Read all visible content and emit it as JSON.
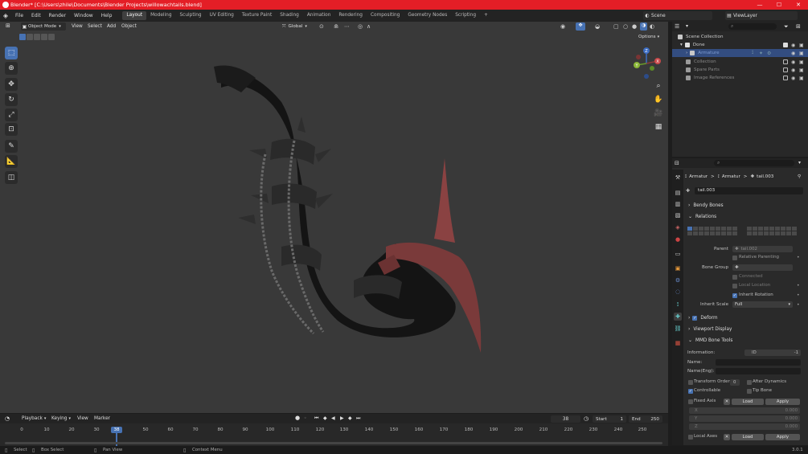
{
  "app": {
    "title": "Blender* [C:\\Users\\zhile\\Documents\\Blender Projects\\willowachtails.blend]"
  },
  "window_controls": {
    "minimize": "—",
    "maximize": "☐",
    "close": "✕"
  },
  "menu": {
    "items": [
      "File",
      "Edit",
      "Render",
      "Window",
      "Help"
    ]
  },
  "workspaces": {
    "tabs": [
      "Layout",
      "Modeling",
      "Sculpting",
      "UV Editing",
      "Texture Paint",
      "Shading",
      "Animation",
      "Rendering",
      "Compositing",
      "Geometry Nodes",
      "Scripting"
    ],
    "active": "Layout",
    "add": "+"
  },
  "scene": {
    "name": "Scene",
    "view_layer": "ViewLayer"
  },
  "viewport": {
    "mode": "Object Mode",
    "menus": [
      "View",
      "Select",
      "Add",
      "Object"
    ],
    "orientation": "Global",
    "options_label": "Options"
  },
  "gizmo": {
    "x": "X",
    "y": "Y",
    "z": "Z"
  },
  "outliner": {
    "search_placeholder": "",
    "root": "Scene Collection",
    "rows": [
      {
        "label": "Done"
      },
      {
        "label": "Armature"
      },
      {
        "label": "Collection"
      },
      {
        "label": "Spare Parts"
      },
      {
        "label": "Image References"
      }
    ]
  },
  "properties": {
    "breadcrumb": {
      "a": "Armatur",
      "b": "Armatur",
      "c": "tail.003",
      "sep": ">"
    },
    "bone_name": "tail.003",
    "panels": {
      "bendy": "Bendy Bones",
      "relations": "Relations",
      "deform": "Deform",
      "viewport_display": "Viewport Display",
      "mmd": "MMD Bone Tools"
    },
    "relations": {
      "parent_label": "Parent",
      "parent_value": "tail.002",
      "relative_parenting": "Relative Parenting",
      "bone_group_label": "Bone Group",
      "connected": "Connected",
      "local_location": "Local Location",
      "inherit_rotation": "Inherit Rotation",
      "inherit_scale_label": "Inherit Scale",
      "inherit_scale_value": "Full"
    },
    "mmd": {
      "information_label": "Information:",
      "id_label": "ID",
      "id_value": "-1",
      "name_label": "Name:",
      "name_eng_label": "Name(Eng):",
      "transform_order_label": "Transform Order",
      "transform_order_value": "0",
      "after_dynamics": "After Dynamics",
      "controllable": "Controllable",
      "tip_bone": "Tip Bone",
      "fixed_axis": "Fixed Axis",
      "local_axes": "Local Axes",
      "load": "Load",
      "apply": "Apply",
      "x_label": "X",
      "y_label": "Y",
      "z_label": "Z",
      "x_value": "0.000",
      "y_value": "0.000",
      "z_value": "0.000",
      "x_mark": "✕"
    }
  },
  "timeline": {
    "menus": [
      "Playback",
      "Keying",
      "View",
      "Marker"
    ],
    "current_frame": "38",
    "start_label": "Start",
    "start_value": "1",
    "end_label": "End",
    "end_value": "250",
    "ticks": [
      "0",
      "10",
      "20",
      "30",
      "38",
      "50",
      "60",
      "70",
      "80",
      "90",
      "100",
      "110",
      "120",
      "130",
      "140",
      "150",
      "160",
      "170",
      "180",
      "190",
      "200",
      "210",
      "220",
      "230",
      "240",
      "250"
    ]
  },
  "statusbar": {
    "select": "Select",
    "box_select": "Box Select",
    "pan_view": "Pan View",
    "context_menu": "Context Menu",
    "version": "3.0.1"
  },
  "colors": {
    "accent": "#4772b3",
    "titlebar": "#e41e26",
    "selection": "#334d80",
    "frame_marker": "#4772b3"
  }
}
